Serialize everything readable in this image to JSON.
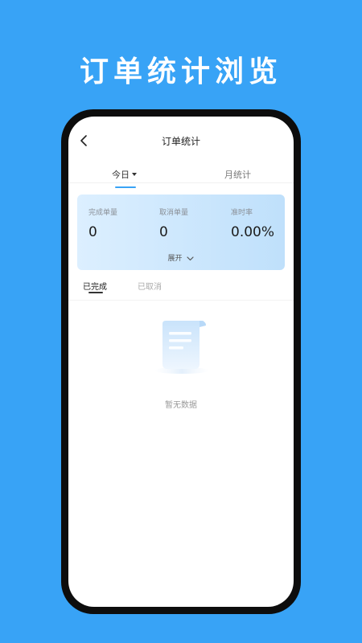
{
  "promo": {
    "title": "订单统计浏览"
  },
  "nav": {
    "back_icon": "chevron-left-icon",
    "title": "订单统计"
  },
  "tabs": {
    "today_label": "今日",
    "today_icon": "caret-down-icon",
    "month_label": "月统计",
    "active": "今日",
    "accent_color": "#38a3f6"
  },
  "stats": [
    {
      "label": "完成单量",
      "value": "0"
    },
    {
      "label": "取消单量",
      "value": "0"
    },
    {
      "label": "准时率",
      "value": "0.00%"
    }
  ],
  "expand": {
    "label": "展开",
    "icon": "chevron-down-icon"
  },
  "order_tabs": {
    "completed_label": "已完成",
    "cancelled_label": "已取消",
    "active": "已完成"
  },
  "empty_state": {
    "icon": "empty-document-icon",
    "text": "暂无数据"
  },
  "colors": {
    "background": "#38a3f6",
    "card_gradient_start": "#dcefff",
    "card_gradient_end": "#bfe0fb"
  }
}
